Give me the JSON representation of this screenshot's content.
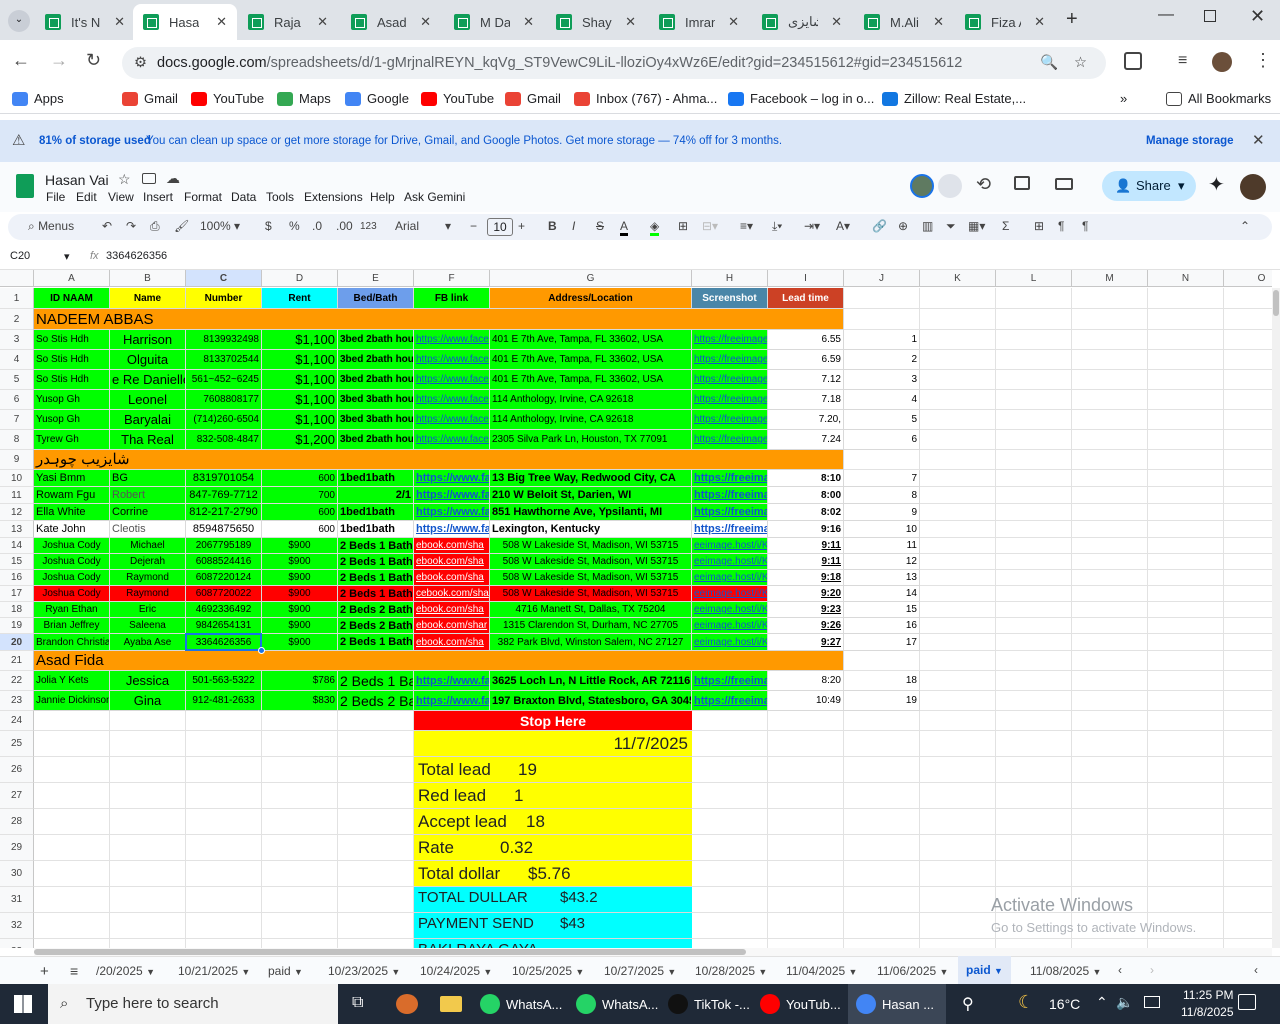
{
  "browser": {
    "tabs": [
      {
        "label": "It's N"
      },
      {
        "label": "Hasan"
      },
      {
        "label": "Raja"
      },
      {
        "label": "Asad"
      },
      {
        "label": "M Da"
      },
      {
        "label": "Shaya"
      },
      {
        "label": "Imran"
      },
      {
        "label": "شایزی"
      },
      {
        "label": "M.Ali"
      },
      {
        "label": "Fiza A"
      }
    ],
    "url_host": "docs.google.com",
    "url_path": "/spreadsheets/d/1-gMrjnalREYN_kqVg_ST9VewC9LiL-lloziOy4xWz6E/edit?gid=234515612#gid=234515612",
    "bookmarks": [
      {
        "label": "Apps",
        "color": "#4285f4"
      },
      {
        "label": "Gmail",
        "color": "#ea4335"
      },
      {
        "label": "YouTube",
        "color": "#ff0000"
      },
      {
        "label": "Maps",
        "color": "#34a853"
      },
      {
        "label": "Google",
        "color": "#4285f4"
      },
      {
        "label": "YouTube",
        "color": "#ff0000"
      },
      {
        "label": "Gmail",
        "color": "#ea4335"
      },
      {
        "label": "Inbox (767) - Ahma...",
        "color": "#ea4335"
      },
      {
        "label": "Facebook – log in o...",
        "color": "#1877f2"
      },
      {
        "label": "Zillow: Real Estate,...",
        "color": "#1277e1"
      }
    ],
    "all_bookmarks": "All Bookmarks"
  },
  "notice": {
    "bold": "81% of storage used",
    "text": "You can clean up space or get more storage for Drive, Gmail, and Google Photos. Get more storage — 74% off for 3 months.",
    "action": "Manage storage"
  },
  "doc": {
    "title": "Hasan Vai",
    "menus": [
      "File",
      "Edit",
      "View",
      "Insert",
      "Format",
      "Data",
      "Tools",
      "Extensions",
      "Help",
      "Ask Gemini"
    ],
    "share": "Share",
    "toolbar": {
      "menus": "Menus",
      "zoom": "100%",
      "currency": "$",
      "percent": "%",
      "dec_down": ".0",
      "dec_up": ".00",
      "format123": "123",
      "font": "Arial",
      "font_size": "10"
    },
    "name_box": "C20",
    "formula_value": "3364626356"
  },
  "grid": {
    "columns": [
      "A",
      "B",
      "C",
      "D",
      "E",
      "F",
      "G",
      "H",
      "I",
      "J",
      "K",
      "L",
      "M",
      "N",
      "O"
    ],
    "rows": [
      {
        "n": "1",
        "cells": [
          "ID NAAM",
          "Name",
          "Number",
          "Rent",
          "Bed/Bath",
          "FB link",
          "Address/Location",
          "Screenshot",
          "Lead time",
          "",
          "",
          "",
          "",
          "",
          ""
        ]
      },
      {
        "n": "2",
        "cells": [
          "NADEEM ABBAS",
          "",
          "",
          "",
          "",
          "",
          "",
          "",
          "",
          "",
          "",
          "",
          "",
          "",
          ""
        ]
      },
      {
        "n": "3",
        "cells": [
          "So Stis Hdh",
          "Harrison",
          "8139932498",
          "$1,100",
          "3bed 2bath hou",
          "https://www.face",
          "401 E 7th Ave, Tampa, FL 33602, USA",
          "https://freeimage",
          "6.55",
          "1",
          "",
          "",
          "",
          "",
          ""
        ]
      },
      {
        "n": "4",
        "cells": [
          "So Stis Hdh",
          "Olguita",
          "8133702544",
          "$1,100",
          "3bed 2bath hou",
          "https://www.face",
          "401 E 7th Ave, Tampa, FL 33602, USA",
          "https://freeimage",
          "6.59",
          "2",
          "",
          "",
          "",
          "",
          ""
        ]
      },
      {
        "n": "5",
        "cells": [
          "So Stis Hdh",
          "e Re Danielle",
          "561~452~6245",
          "$1,100",
          "3bed 2bath hou",
          "https://www.face",
          "401 E 7th Ave, Tampa, FL 33602, USA",
          "https://freeimage",
          "7.12",
          "3",
          "",
          "",
          "",
          "",
          ""
        ]
      },
      {
        "n": "6",
        "cells": [
          "Yusop Gh",
          "Leonel",
          "7608808177",
          "$1,100",
          "3bed 3bath hou",
          "https://www.face",
          "114 Anthology, Irvine, CA 92618",
          "https://freeimage",
          "7.18",
          "4",
          "",
          "",
          "",
          "",
          ""
        ]
      },
      {
        "n": "7",
        "cells": [
          "Yusop Gh",
          "Baryalai",
          "(714)260-6504",
          "$1,100",
          "3bed 3bath hou",
          "https://www.face",
          "114 Anthology, Irvine, CA 92618",
          "https://freeimage",
          "7.20,",
          "5",
          "",
          "",
          "",
          "",
          ""
        ]
      },
      {
        "n": "8",
        "cells": [
          "Tyrew Gh",
          "Tha Real",
          "832-508-4847",
          "$1,200",
          "3bed 2bath hou",
          "https://www.face",
          "2305 Silva Park Ln, Houston, TX 77091",
          "https://freeimage",
          "7.24",
          "6",
          "",
          "",
          "",
          "",
          ""
        ]
      },
      {
        "n": "9",
        "cells": [
          "شایزیب چوہدر",
          "",
          "",
          "",
          "",
          "",
          "",
          "",
          "",
          "",
          "",
          "",
          "",
          "",
          ""
        ]
      },
      {
        "n": "10",
        "cells": [
          "Yasi Bmm",
          "BG",
          "8319701054",
          "600",
          "1bed1bath",
          "https://www.fac",
          "13 Big Tree Way, Redwood City, CA",
          "https://freeima",
          "8:10",
          "7",
          "",
          "",
          "",
          "",
          ""
        ]
      },
      {
        "n": "11",
        "cells": [
          "Rowam Fgu",
          "Robert",
          "847-769-7712",
          "700",
          "2/1",
          "https://www.fac",
          "210 W Beloit St, Darien, WI",
          "https://freeima",
          "8:00",
          "8",
          "",
          "",
          "",
          "",
          ""
        ]
      },
      {
        "n": "12",
        "cells": [
          "Ella White",
          "Corrine",
          "812-217-2790",
          "600",
          "1bed1bath",
          "https://www.fac",
          "851 Hawthorne Ave, Ypsilanti, MI",
          "https://freeima",
          "8:02",
          "9",
          "",
          "",
          "",
          "",
          ""
        ]
      },
      {
        "n": "13",
        "cells": [
          "Kate John",
          "Cleotis",
          "8594875650",
          "600",
          "1bed1bath",
          "https://www.fac",
          "Lexington, Kentucky",
          "https://freeima",
          "9:16",
          "10",
          "",
          "",
          "",
          "",
          ""
        ]
      },
      {
        "n": "14",
        "cells": [
          "Joshua Cody",
          "Michael",
          "2067795189",
          "$900",
          "2 Beds 1 Bath",
          "ebook.com/sha",
          "508 W Lakeside St, Madison, WI 53715",
          "eeimage.host/i/K",
          "9:11",
          "11",
          "",
          "",
          "",
          "",
          ""
        ]
      },
      {
        "n": "15",
        "cells": [
          "Joshua Cody",
          "Dejerah",
          "6088524416",
          "$900",
          "2 Beds 1 Bath",
          "ebook.com/sha",
          "508 W Lakeside St, Madison, WI 53715",
          "eeimage.host/i/K",
          "9:11",
          "12",
          "",
          "",
          "",
          "",
          ""
        ]
      },
      {
        "n": "16",
        "cells": [
          "Joshua Cody",
          "Raymond",
          "6087220124",
          "$900",
          "2 Beds 1 Bath",
          "ebook.com/sha",
          "508 W Lakeside St, Madison, WI 53715",
          "eeimage.host/i/K",
          "9:18",
          "13",
          "",
          "",
          "",
          "",
          ""
        ]
      },
      {
        "n": "17",
        "cells": [
          "Joshua Cody",
          "Raymond",
          "6087720022",
          "$900",
          "2 Beds 1 Bath",
          "cebook.com/sha",
          "508 W Lakeside St, Madison, WI 53715",
          "eeimage.host/i/K",
          "9:20",
          "14",
          "",
          "",
          "",
          "",
          ""
        ]
      },
      {
        "n": "18",
        "cells": [
          "Ryan Ethan",
          "Eric",
          "4692336492",
          "$900",
          "2 Beds 2 Baths",
          "ebook.com/sha",
          "4716 Manett St, Dallas, TX 75204",
          "eeimage.host/i/K",
          "9:23",
          "15",
          "",
          "",
          "",
          "",
          ""
        ]
      },
      {
        "n": "19",
        "cells": [
          "Brian Jeffrey",
          "Saleena",
          "9842654131",
          "$900",
          "2 Beds 2 Baths",
          "ebook.com/shar",
          "1315 Clarendon St, Durham, NC 27705",
          "eeimage.host/i/K",
          "9:26",
          "16",
          "",
          "",
          "",
          "",
          ""
        ]
      },
      {
        "n": "20",
        "cells": [
          "Brandon Christian",
          "Ayaba Ase",
          "3364626356",
          "$900",
          "2 Beds 1 Bath",
          "ebook.com/sha",
          "382 Park Blvd, Winston Salem, NC 27127",
          "eeimage.host/i/K",
          "9:27",
          "17",
          "",
          "",
          "",
          "",
          ""
        ]
      },
      {
        "n": "21",
        "cells": [
          "Asad Fida",
          "",
          "",
          "",
          "",
          "",
          "",
          "",
          "",
          "",
          "",
          "",
          "",
          "",
          ""
        ]
      },
      {
        "n": "22",
        "cells": [
          "Jolia Y Kets",
          "Jessica",
          "501-563-5322",
          "$786",
          "2 Beds 1 Bath",
          "https://www.fac",
          "3625 Loch Ln, N Little Rock, AR 72116",
          "https://freeima",
          "8:20",
          "18",
          "",
          "",
          "",
          "",
          ""
        ]
      },
      {
        "n": "23",
        "cells": [
          "Jannie Dickinson",
          "Gina",
          "912-481-2633",
          "$830",
          "2 Beds 2 Bath",
          "https://www.fac",
          "197 Braxton Blvd, Statesboro, GA 30458",
          "https://freeima",
          "10:49",
          "19",
          "",
          "",
          "",
          "",
          ""
        ]
      },
      {
        "n": "24",
        "cells": [
          "",
          "",
          "",
          "",
          "",
          "",
          "",
          "",
          "",
          "",
          "",
          "",
          "",
          "",
          ""
        ]
      },
      {
        "n": "25",
        "cells": [
          "",
          "",
          "",
          "",
          "",
          "",
          "",
          "",
          "",
          "",
          "",
          "",
          "",
          "",
          ""
        ]
      },
      {
        "n": "26",
        "cells": [
          "",
          "",
          "",
          "",
          "",
          "",
          "",
          "",
          "",
          "",
          "",
          "",
          "",
          "",
          ""
        ]
      },
      {
        "n": "27",
        "cells": [
          "",
          "",
          "",
          "",
          "",
          "",
          "",
          "",
          "",
          "",
          "",
          "",
          "",
          "",
          ""
        ]
      },
      {
        "n": "28",
        "cells": [
          "",
          "",
          "",
          "",
          "",
          "",
          "",
          "",
          "",
          "",
          "",
          "",
          "",
          "",
          ""
        ]
      },
      {
        "n": "29",
        "cells": [
          "",
          "",
          "",
          "",
          "",
          "",
          "",
          "",
          "",
          "",
          "",
          "",
          "",
          "",
          ""
        ]
      },
      {
        "n": "30",
        "cells": [
          "",
          "",
          "",
          "",
          "",
          "",
          "",
          "",
          "",
          "",
          "",
          "",
          "",
          "",
          ""
        ]
      },
      {
        "n": "31",
        "cells": [
          "",
          "",
          "",
          "",
          "",
          "",
          "",
          "",
          "",
          "",
          "",
          "",
          "",
          "",
          ""
        ]
      },
      {
        "n": "32",
        "cells": [
          "",
          "",
          "",
          "",
          "",
          "",
          "",
          "",
          "",
          "",
          "",
          "",
          "",
          "",
          ""
        ]
      },
      {
        "n": "33",
        "cells": [
          "",
          "",
          "",
          "",
          "",
          "",
          "",
          "",
          "",
          "",
          "",
          "",
          "",
          "",
          ""
        ]
      }
    ],
    "summary": {
      "stop_here": "Stop Here",
      "date": "11/7/2025",
      "total_lead_label": "Total lead",
      "total_lead": "19",
      "red_lead_label": "Red lead",
      "red_lead": "1",
      "accept_lead_label": "Accept lead",
      "accept_lead": "18",
      "rate_label": "Rate",
      "rate": "0.32",
      "total_dollar_label": "Total dollar",
      "total_dollar": "$5.76",
      "total_dullar_label": "TOTAL DULLAR",
      "total_dullar": "$43.2",
      "payment_send_label": "PAYMENT SEND",
      "payment_send": "$43",
      "baki_label": "BAKI RAYA GAYA"
    }
  },
  "sheet_tabs": [
    "/20/2025",
    "10/21/2025",
    "paid",
    "10/23/2025",
    "10/24/2025",
    "10/25/2025",
    "10/27/2025",
    "10/28/2025",
    "11/04/2025",
    "11/06/2025",
    "paid",
    "11/08/2025"
  ],
  "active_sheet_index": 10,
  "watermark": {
    "title": "Activate Windows",
    "subtitle": "Go to Settings to activate Windows."
  },
  "taskbar": {
    "search_placeholder": "Type here to search",
    "apps": [
      {
        "label": "WhatsA...",
        "color": "#25d366"
      },
      {
        "label": "WhatsA...",
        "color": "#25d366"
      },
      {
        "label": "TikTok -...",
        "color": "#111"
      },
      {
        "label": "YouTub...",
        "color": "#ff0000"
      },
      {
        "label": "Hasan ...",
        "color": "#4285f4"
      }
    ],
    "temperature": "16°C",
    "time": "11:25 PM",
    "date": "11/8/2025"
  },
  "colors": {
    "green": "#00ff00",
    "orange": "#ff9900",
    "yellow": "#ffff00",
    "red": "#ff0000",
    "cyan": "#00ffff",
    "lightgreen": "#b6d7a8"
  }
}
